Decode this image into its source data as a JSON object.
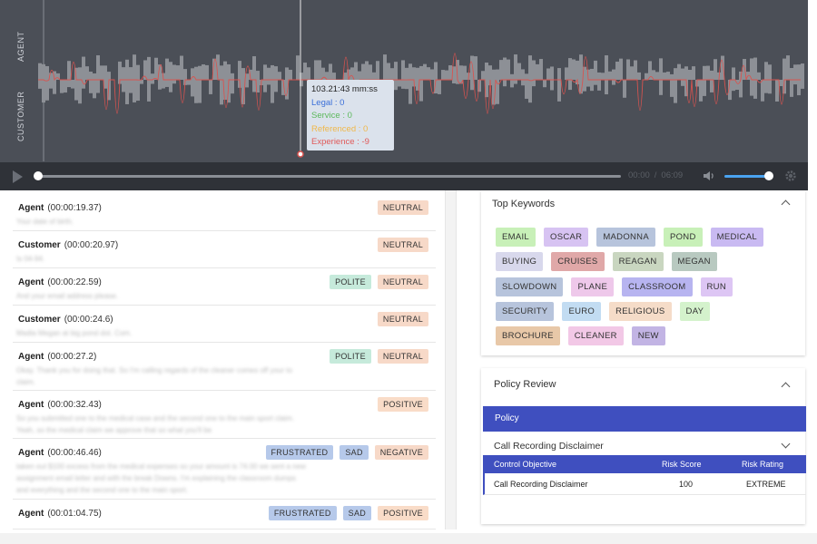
{
  "waveform": {
    "agent_label": "AGENT",
    "customer_label": "CUSTOMER",
    "tooltip": {
      "time": "103.21:43 mm:ss",
      "legal": "Legal : 0",
      "service": "Service : 0",
      "referenced": "Referenced : 0",
      "experience": "Experience : -9"
    }
  },
  "player": {
    "current_time": "00:00",
    "separator": "/",
    "total_time": "06:09",
    "progress": 0.0,
    "volume": 0.85
  },
  "transcript": [
    {
      "speaker": "Agent",
      "time": "(00:00:19.37)",
      "tags": [
        "NEUTRAL"
      ],
      "text": [
        "Your date of birth."
      ]
    },
    {
      "speaker": "Customer",
      "time": "(00:00:20.97)",
      "tags": [
        "NEUTRAL"
      ],
      "text": [
        "Is 04-94."
      ]
    },
    {
      "speaker": "Agent",
      "time": "(00:00:22.59)",
      "tags": [
        "POLITE",
        "NEUTRAL"
      ],
      "text": [
        "And your email address please."
      ]
    },
    {
      "speaker": "Customer",
      "time": "(00:00:24.6)",
      "tags": [
        "NEUTRAL"
      ],
      "text": [
        "Madia Megan at big pond dot. Com."
      ]
    },
    {
      "speaker": "Agent",
      "time": "(00:00:27.2)",
      "tags": [
        "POLITE",
        "NEUTRAL"
      ],
      "text": [
        "Okay. Thank you for doing that. So I'm calling regards of the cleaner comes off your to",
        "claim."
      ]
    },
    {
      "speaker": "Agent",
      "time": "(00:00:32.43)",
      "tags": [
        "POSITIVE"
      ],
      "text": [
        "So you submitted one to the medical case and the second one to the main sport claim.",
        "Yeah, so the medical claim we approve that so what you'll be"
      ]
    },
    {
      "speaker": "Agent",
      "time": "(00:00:46.46)",
      "tags": [
        "FRUSTRATED",
        "SAD",
        "NEGATIVE"
      ],
      "text": [
        "taken out $100 excess from the medical expenses so your amount is 74.00 we sent a new",
        "assignment email letter and with the break Downs. I'm explaining the classroom dumps",
        "and everything and the second one to the main sport."
      ]
    },
    {
      "speaker": "Agent",
      "time": "(00:01:04.75)",
      "tags": [
        "FRUSTRATED",
        "SAD",
        "POSITIVE"
      ],
      "text": []
    }
  ],
  "keywords": {
    "title": "Top Keywords",
    "rows": [
      [
        {
          "label": "EMAIL",
          "color": "#c8f0b8"
        },
        {
          "label": "OSCAR",
          "color": "#d7c3f2"
        },
        {
          "label": "MADONNA",
          "color": "#b7c4dc"
        },
        {
          "label": "POND",
          "color": "#c8f0b8"
        },
        {
          "label": "MEDICAL",
          "color": "#c9baf2"
        }
      ],
      [
        {
          "label": "BUYING",
          "color": "#d8d8ec"
        },
        {
          "label": "CRUISES",
          "color": "#e0a8a8"
        },
        {
          "label": "REAGAN",
          "color": "#c9d6c0"
        },
        {
          "label": "MEGAN",
          "color": "#b8c9c0"
        }
      ],
      [
        {
          "label": "SLOWDOWN",
          "color": "#b7c4dc"
        },
        {
          "label": "PLANE",
          "color": "#eec8ea"
        },
        {
          "label": "CLASSROOM",
          "color": "#b7b4f0"
        },
        {
          "label": "RUN",
          "color": "#ddc6f4"
        }
      ],
      [
        {
          "label": "SECURITY",
          "color": "#b7c4dc"
        },
        {
          "label": "EURO",
          "color": "#c2dcf2"
        },
        {
          "label": "RELIGIOUS",
          "color": "#f5dcc8"
        },
        {
          "label": "DAY",
          "color": "#d4f2cc"
        }
      ],
      [
        {
          "label": "BROCHURE",
          "color": "#e8c8a8"
        },
        {
          "label": "CLEANER",
          "color": "#f2c8e6"
        },
        {
          "label": "NEW",
          "color": "#c2b4e4"
        }
      ]
    ]
  },
  "policy": {
    "title": "Policy Review",
    "bar": "Policy",
    "disclaimer": "Call Recording Disclaimer",
    "headers": {
      "objective": "Control Objective",
      "score": "Risk Score",
      "rating": "Risk Rating"
    },
    "row": {
      "objective": "Call Recording Disclaimer",
      "score": "100",
      "rating": "EXTREME"
    }
  }
}
